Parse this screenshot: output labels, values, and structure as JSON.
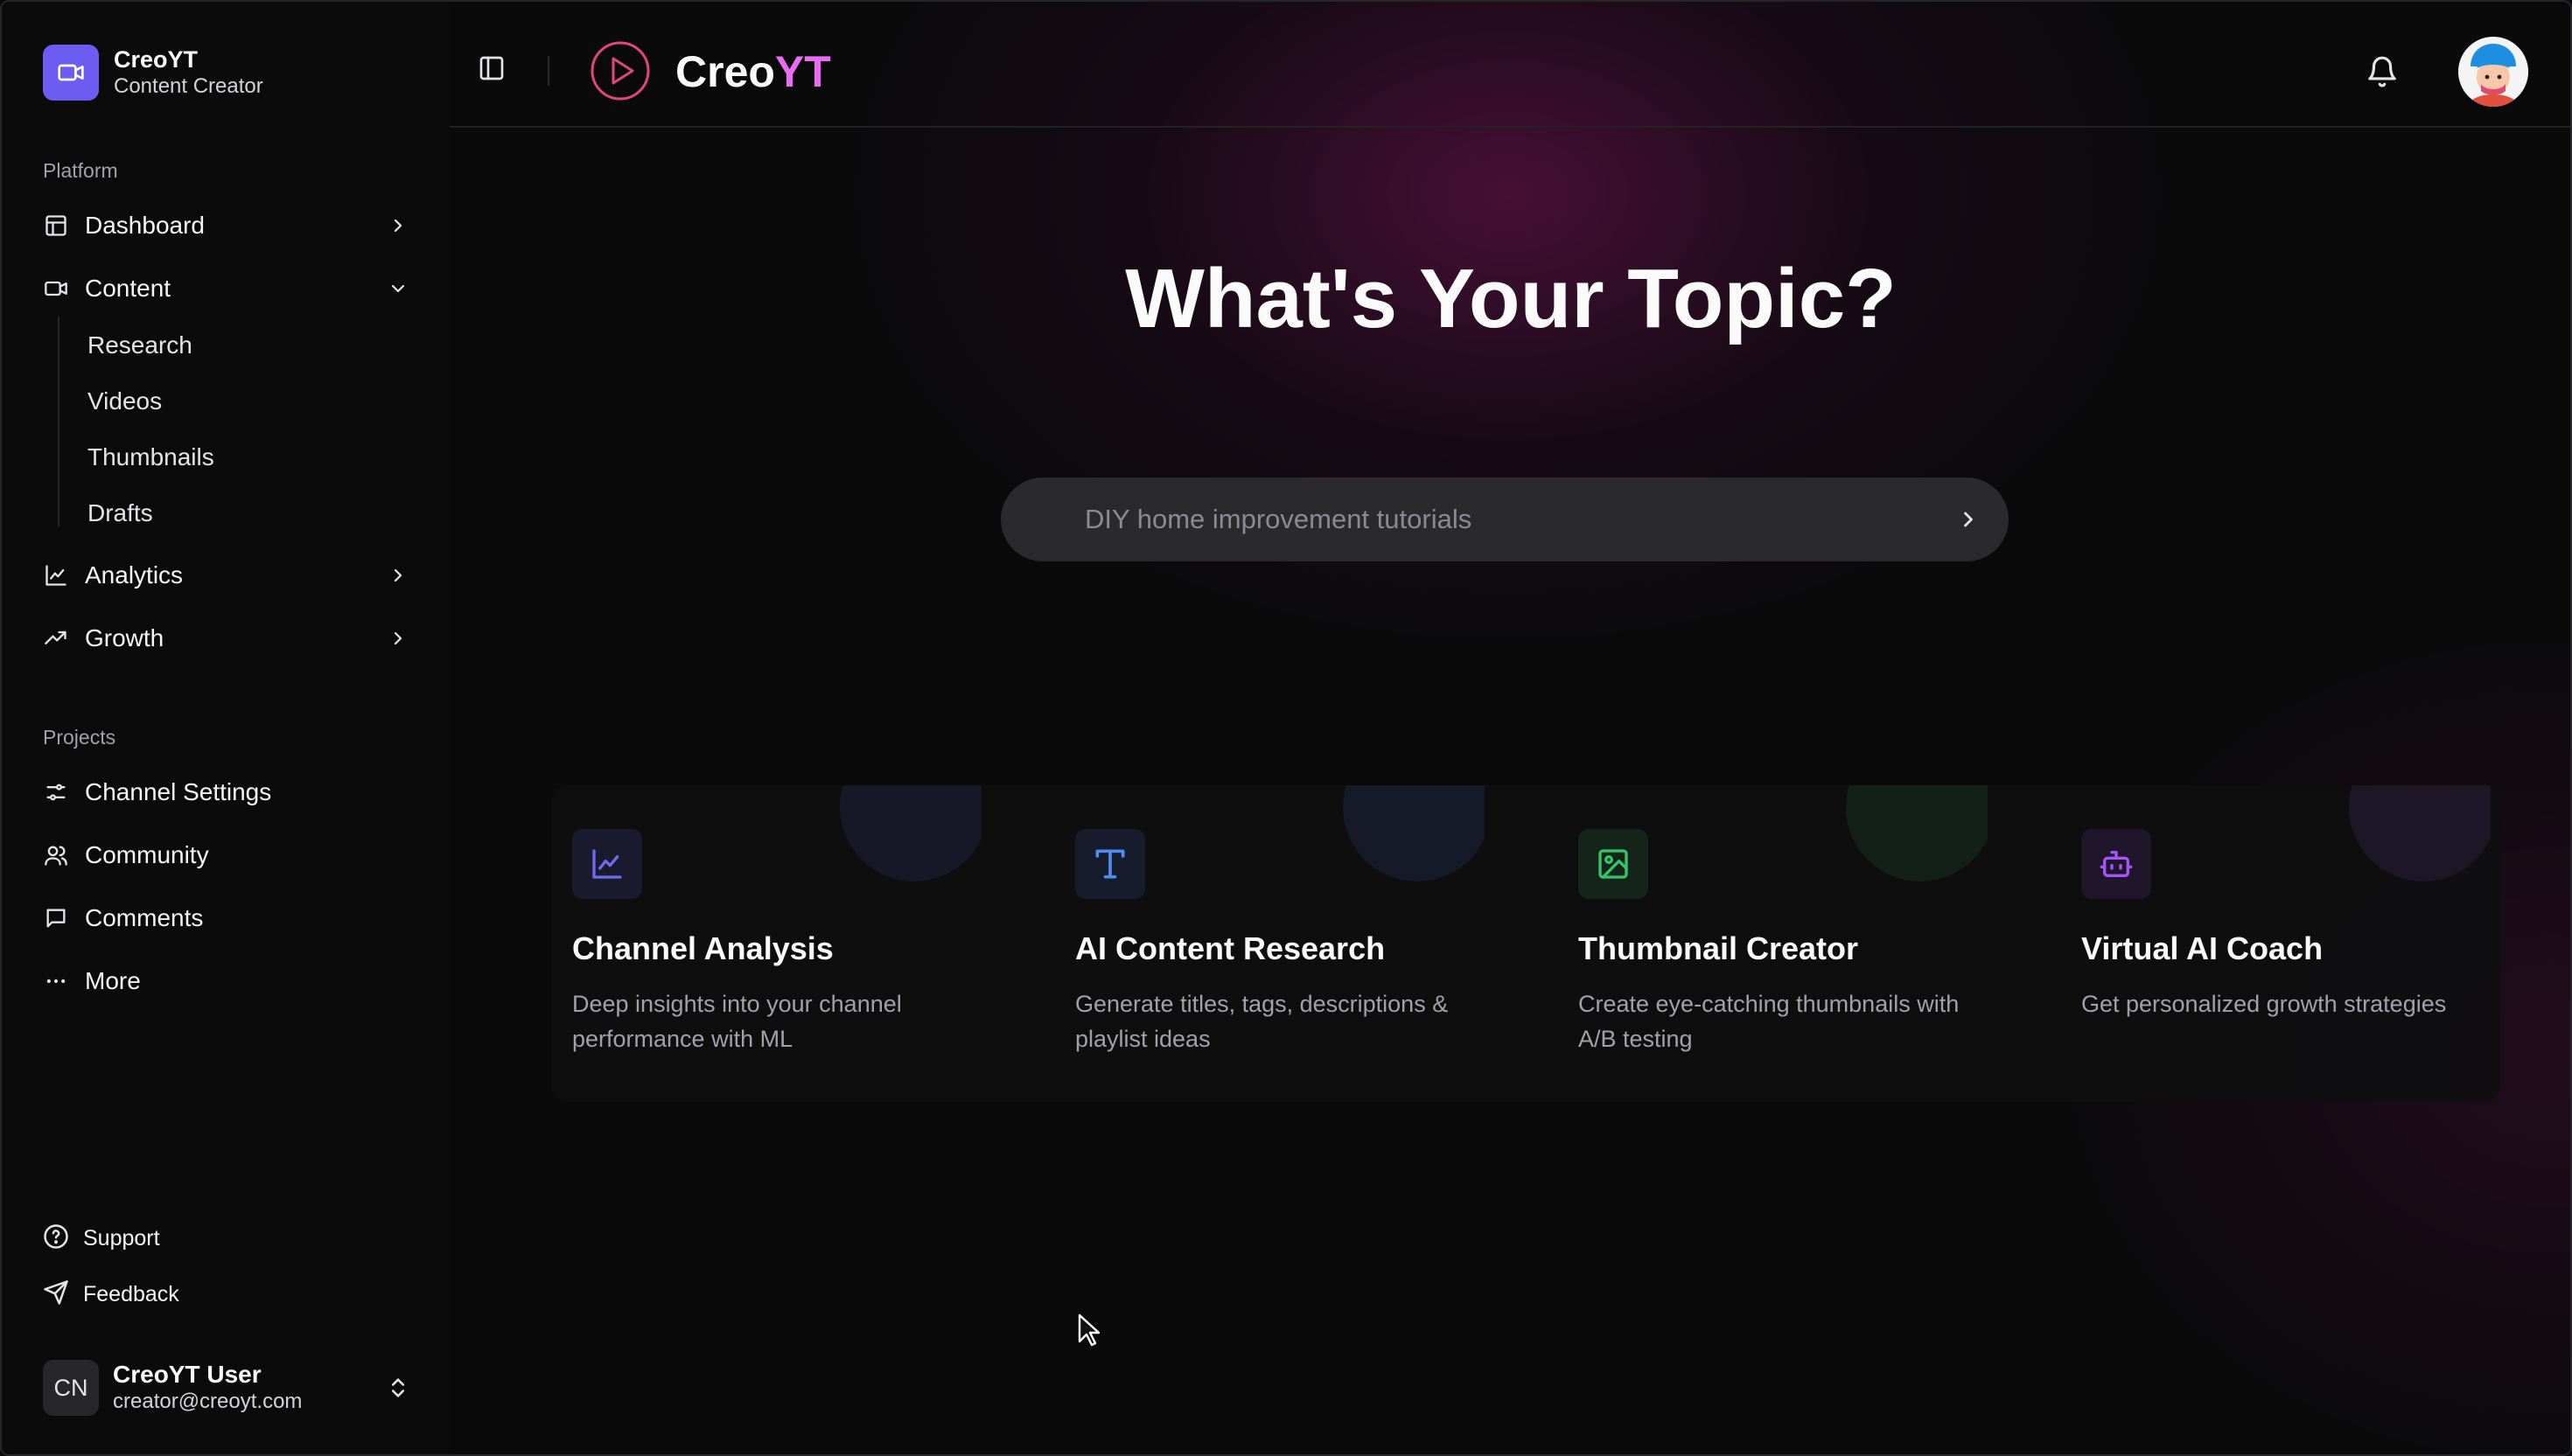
{
  "brand": {
    "name": "CreoYT",
    "subtitle": "Content Creator"
  },
  "sidebar": {
    "platform_label": "Platform",
    "nav": [
      {
        "label": "Dashboard",
        "icon": "layout-icon",
        "expanded": false
      },
      {
        "label": "Content",
        "icon": "video-icon",
        "expanded": true
      },
      {
        "label": "Analytics",
        "icon": "line-chart-icon",
        "expanded": false
      },
      {
        "label": "Growth",
        "icon": "trending-up-icon",
        "expanded": false
      }
    ],
    "content_sub": [
      "Research",
      "Videos",
      "Thumbnails",
      "Drafts"
    ],
    "projects_label": "Projects",
    "projects": [
      {
        "label": "Channel Settings",
        "icon": "sliders-icon"
      },
      {
        "label": "Community",
        "icon": "users-icon"
      },
      {
        "label": "Comments",
        "icon": "message-icon"
      },
      {
        "label": "More",
        "icon": "more-icon"
      }
    ],
    "footer": [
      {
        "label": "Support",
        "icon": "help-icon"
      },
      {
        "label": "Feedback",
        "icon": "send-icon"
      }
    ],
    "user": {
      "initials": "CN",
      "name": "CreoYT User",
      "email": "creator@creoyt.com"
    }
  },
  "header": {
    "title_main": "Creo",
    "title_accent": "YT"
  },
  "hero": {
    "headline": "What's Your Topic?",
    "search_placeholder": "DIY home improvement tutorials"
  },
  "features": [
    {
      "title": "Channel Analysis",
      "description": "Deep insights into your channel performance with ML",
      "icon": "chart-icon",
      "color": "#6d6cf0"
    },
    {
      "title": "AI Content Research",
      "description": "Generate titles, tags, descriptions & playlist ideas",
      "icon": "type-icon",
      "color": "#4f8df5"
    },
    {
      "title": "Thumbnail Creator",
      "description": "Create eye-catching thumbnails with A/B testing",
      "icon": "image-icon",
      "color": "#33c56a"
    },
    {
      "title": "Virtual AI Coach",
      "description": "Get personalized growth strategies",
      "icon": "bot-icon",
      "color": "#a855f7"
    }
  ],
  "colors": {
    "accent": "#e86df0",
    "brand": "#6d5cf2",
    "play_ring": "#e0457f"
  }
}
